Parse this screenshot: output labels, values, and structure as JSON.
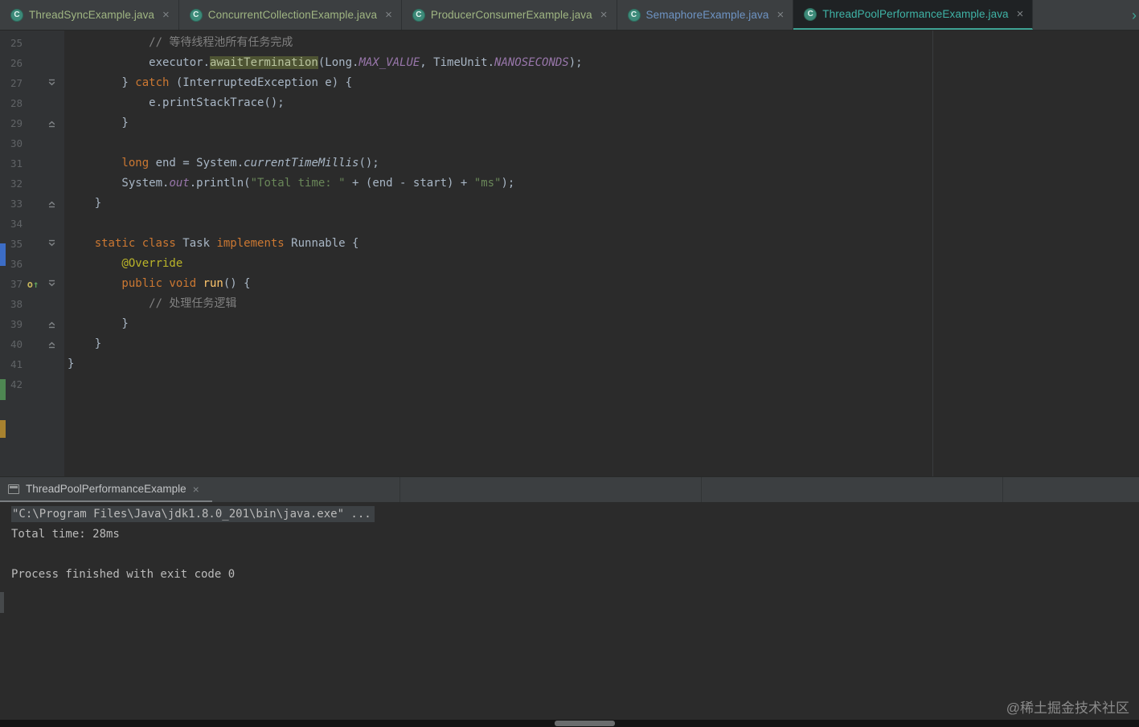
{
  "ui": {
    "close_glyph": "×",
    "class_icon_glyph": "C",
    "override_glyph": "o↑",
    "more_tabs_glyph": "›"
  },
  "colors": {
    "accent": "#3FA394",
    "tab_green": "#9FB582",
    "tab_blue": "#6E94C4",
    "tab_teal": "#3FB3A6"
  },
  "editor_tabs": [
    {
      "label": "ThreadSyncExample.java",
      "color": "#9FB582",
      "active": false
    },
    {
      "label": "ConcurrentCollectionExample.java",
      "color": "#9FB582",
      "active": false
    },
    {
      "label": "ProducerConsumerExample.java",
      "color": "#9FB582",
      "active": false
    },
    {
      "label": "SemaphoreExample.java",
      "color": "#6E94C4",
      "active": false
    },
    {
      "label": "ThreadPoolPerformanceExample.java",
      "color": "#3FB3A6",
      "active": true
    }
  ],
  "editor": {
    "lines": [
      {
        "n": "25",
        "ind": 12,
        "seg": [
          {
            "s": "com",
            "t": "// 等待线程池所有任务完成"
          }
        ]
      },
      {
        "n": "26",
        "ind": 12,
        "seg": [
          {
            "s": "def",
            "t": "executor."
          },
          {
            "s": "hl",
            "t": "awaitTermination"
          },
          {
            "s": "def",
            "t": "(Long."
          },
          {
            "s": "const",
            "t": "MAX_VALUE"
          },
          {
            "s": "def",
            "t": ", TimeUnit."
          },
          {
            "s": "const",
            "t": "NANOSECONDS"
          },
          {
            "s": "def",
            "t": ");"
          }
        ]
      },
      {
        "n": "27",
        "ind": 8,
        "fold": "start",
        "seg": [
          {
            "s": "def",
            "t": "} "
          },
          {
            "s": "kw",
            "t": "catch"
          },
          {
            "s": "def",
            "t": " (InterruptedException e) {"
          }
        ]
      },
      {
        "n": "28",
        "ind": 12,
        "seg": [
          {
            "s": "def",
            "t": "e.printStackTrace();"
          }
        ]
      },
      {
        "n": "29",
        "ind": 8,
        "fold": "end",
        "seg": [
          {
            "s": "def",
            "t": "}"
          }
        ]
      },
      {
        "n": "30",
        "ind": 0,
        "seg": []
      },
      {
        "n": "31",
        "ind": 8,
        "seg": [
          {
            "s": "kw",
            "t": "long"
          },
          {
            "s": "def",
            "t": " end = System."
          },
          {
            "s": "sm",
            "t": "currentTimeMillis"
          },
          {
            "s": "def",
            "t": "();"
          }
        ]
      },
      {
        "n": "32",
        "ind": 8,
        "seg": [
          {
            "s": "def",
            "t": "System."
          },
          {
            "s": "sf",
            "t": "out"
          },
          {
            "s": "def",
            "t": ".println("
          },
          {
            "s": "str",
            "t": "\"Total time: \""
          },
          {
            "s": "def",
            "t": " + (end - start) + "
          },
          {
            "s": "str",
            "t": "\"ms\""
          },
          {
            "s": "def",
            "t": ");"
          }
        ]
      },
      {
        "n": "33",
        "ind": 4,
        "fold": "end",
        "seg": [
          {
            "s": "def",
            "t": "}"
          }
        ]
      },
      {
        "n": "34",
        "ind": 0,
        "seg": []
      },
      {
        "n": "35",
        "ind": 4,
        "fold": "start",
        "seg": [
          {
            "s": "kw",
            "t": "static class"
          },
          {
            "s": "def",
            "t": " Task "
          },
          {
            "s": "kw",
            "t": "implements"
          },
          {
            "s": "def",
            "t": " Runnable {"
          }
        ]
      },
      {
        "n": "36",
        "ind": 8,
        "seg": [
          {
            "s": "ann",
            "t": "@Override"
          }
        ]
      },
      {
        "n": "37",
        "ind": 8,
        "fold": "start",
        "ovr": true,
        "seg": [
          {
            "s": "kw",
            "t": "public void"
          },
          {
            "s": "def",
            "t": " "
          },
          {
            "s": "m",
            "t": "run"
          },
          {
            "s": "def",
            "t": "() {"
          }
        ]
      },
      {
        "n": "38",
        "ind": 12,
        "seg": [
          {
            "s": "com",
            "t": "// 处理任务逻辑"
          }
        ]
      },
      {
        "n": "39",
        "ind": 8,
        "fold": "end",
        "seg": [
          {
            "s": "def",
            "t": "}"
          }
        ]
      },
      {
        "n": "40",
        "ind": 4,
        "fold": "end",
        "seg": [
          {
            "s": "def",
            "t": "}"
          }
        ]
      },
      {
        "n": "41",
        "ind": 0,
        "seg": [
          {
            "s": "def",
            "t": "}"
          }
        ]
      },
      {
        "n": "42",
        "ind": 0,
        "seg": []
      }
    ]
  },
  "console": {
    "tab_label": "ThreadPoolPerformanceExample",
    "lines": [
      {
        "segments": [
          {
            "t": "\"C:\\Program Files\\Java\\jdk1.8.0_201\\bin\\java.exe\" ...",
            "s": "fold"
          }
        ]
      },
      {
        "segments": [
          {
            "t": "Total time: 28ms",
            "s": "plain"
          }
        ]
      },
      {
        "segments": []
      },
      {
        "segments": [
          {
            "t": "Process finished with exit code 0",
            "s": "plain"
          }
        ]
      }
    ]
  },
  "watermark": "@稀土掘金技术社区"
}
